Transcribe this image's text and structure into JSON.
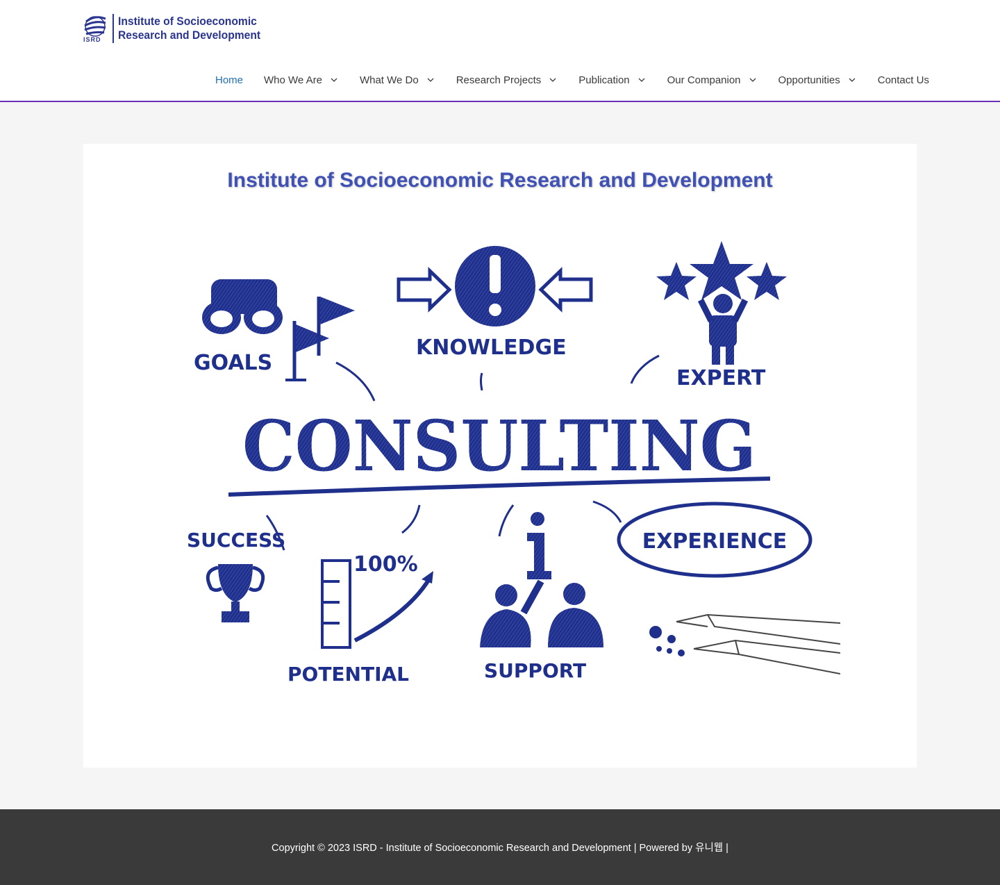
{
  "header": {
    "logo": {
      "abbr": "ISRD",
      "line1": "Institute of Socioeconomic",
      "line2": "Research and Development"
    },
    "nav": [
      {
        "label": "Home",
        "has_dropdown": false,
        "active": true
      },
      {
        "label": "Who We Are",
        "has_dropdown": true,
        "active": false
      },
      {
        "label": "What We Do",
        "has_dropdown": true,
        "active": false
      },
      {
        "label": "Research Projects",
        "has_dropdown": true,
        "active": false
      },
      {
        "label": "Publication",
        "has_dropdown": true,
        "active": false
      },
      {
        "label": "Our Companion",
        "has_dropdown": true,
        "active": false
      },
      {
        "label": "Opportunities",
        "has_dropdown": true,
        "active": false
      },
      {
        "label": "Contact Us",
        "has_dropdown": false,
        "active": false
      }
    ]
  },
  "main": {
    "title": "Institute of Socioeconomic Research and Development",
    "hero": {
      "words": {
        "goals": "GOALS",
        "knowledge": "KNOWLEDGE",
        "expert": "EXPERT",
        "consulting": "CONSULTING",
        "success": "SUCCESS",
        "percent": "100%",
        "potential": "POTENTIAL",
        "support": "SUPPORT",
        "experience": "EXPERIENCE"
      },
      "icons": [
        "binoculars-icon",
        "flags-icon",
        "exclamation-icon",
        "arrow-right-icon",
        "arrow-left-icon",
        "stars-icon",
        "person-raised-arms-icon",
        "trophy-icon",
        "ruler-chart-icon",
        "info-icon",
        "people-icon",
        "pens-icon"
      ]
    }
  },
  "footer": {
    "copyright": "Copyright © 2023 ISRD - Institute of Socioeconomic Research and Development | Powered by",
    "powered_by": "유니웹",
    "trailing": "|"
  },
  "colors": {
    "accent": "#3f51b5",
    "nav_active": "#1e6fb5",
    "header_border": "#6a2fb8",
    "brand_blue": "#2a3590",
    "footer_bg": "#3a3a3a",
    "illustration_blue": "#1f2f8c"
  }
}
